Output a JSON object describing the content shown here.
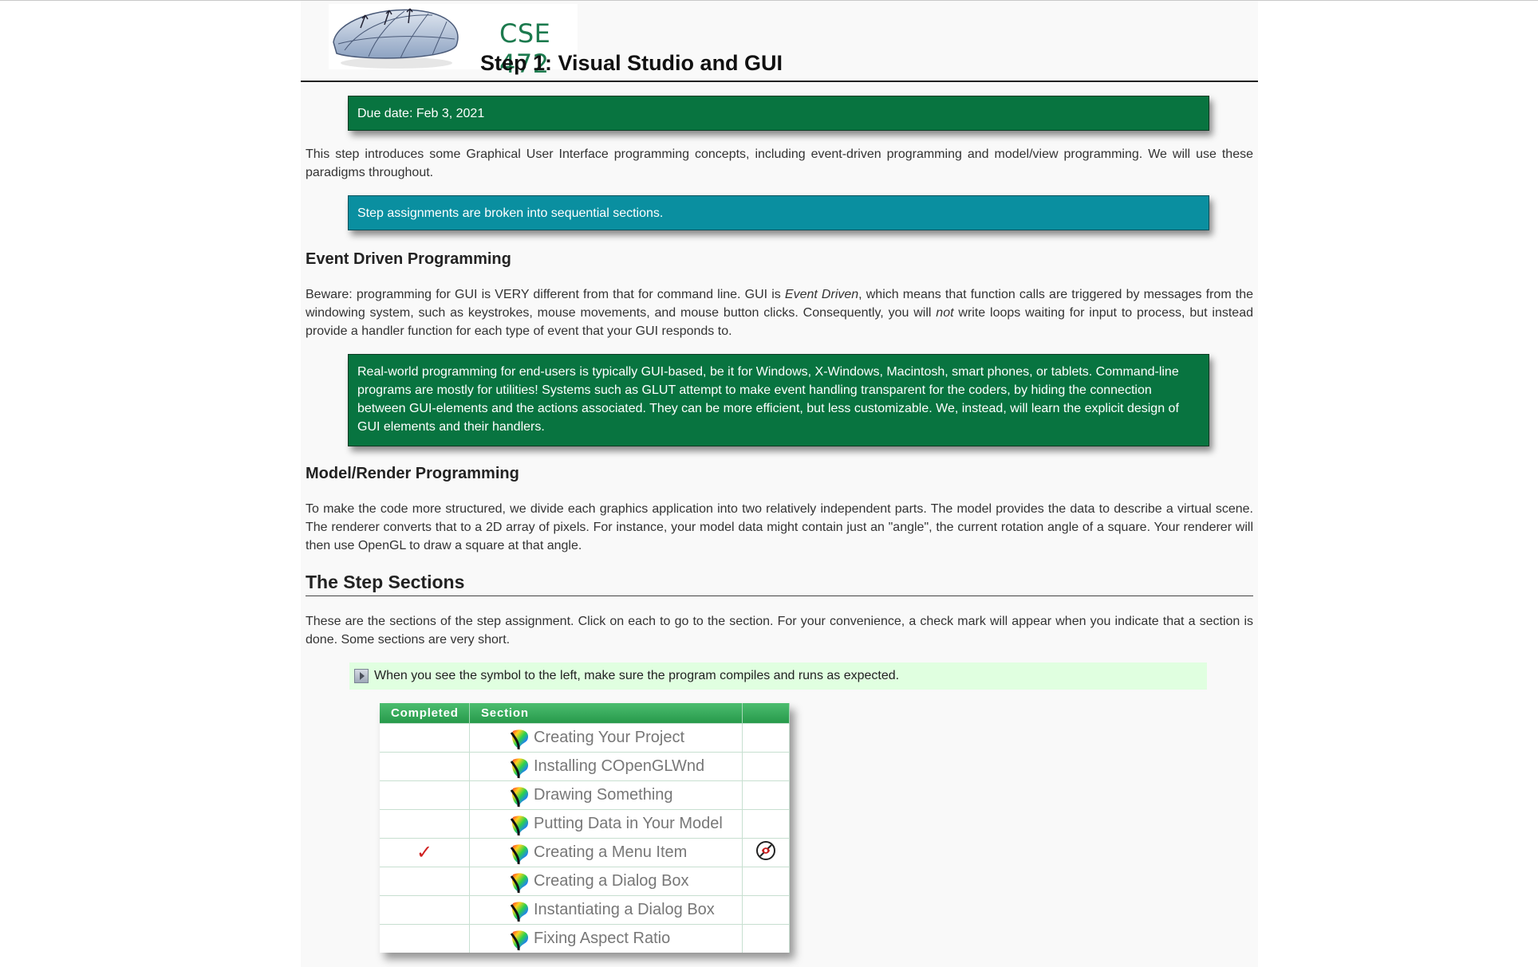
{
  "header": {
    "logo_text": "CSE 472",
    "title": "Step 1: Visual Studio and GUI"
  },
  "due_callout": "Due date: Feb 3, 2021",
  "intro_paragraph": "This step introduces some Graphical User Interface programming concepts, including event-driven programming and model/view programming. We will use these paradigms throughout.",
  "sections_callout": "Step assignments are broken into sequential sections.",
  "event_driven": {
    "heading": "Event Driven Programming",
    "para_part1": "Beware: programming for GUI is VERY different from that for command line. GUI is ",
    "para_em1": "Event Driven",
    "para_part2": ", which means that function calls are triggered by messages from the windowing system, such as keystrokes, mouse movements, and mouse button clicks. Consequently, you will ",
    "para_em2": "not",
    "para_part3": " write loops waiting for input to process, but instead provide a handler function for each type of event that your GUI responds to.",
    "callout": "Real-world programming for end-users is typically GUI-based, be it for Windows, X-Windows, Macintosh, smart phones, or tablets. Command-line programs are mostly for utilities! Systems such as GLUT attempt to make event handling transparent for the coders, by hiding the connection between GUI-elements and the actions associated. They can be more efficient, but less customizable. We, instead, will learn the explicit design of GUI elements and their handlers."
  },
  "model_render": {
    "heading": "Model/Render Programming",
    "paragraph": "To make the code more structured, we divide each graphics application into two relatively independent parts. The model provides the data to describe a virtual scene. The renderer converts that to a 2D array of pixels. For instance, your model data might contain just an \"angle\", the current rotation angle of a square. Your renderer will then use OpenGL to draw a square at that angle."
  },
  "step_sections": {
    "heading": "The Step Sections",
    "paragraph": "These are the sections of the step assignment. Click on each to go to the section. For your convenience, a check mark will appear when you indicate that a section is done. Some sections are very short.",
    "note": "When you see the symbol to the left, make sure the program compiles and runs as expected.",
    "note_icon": "play-icon",
    "table": {
      "headers": [
        "Completed",
        "Section",
        ""
      ],
      "rows": [
        {
          "completed": "",
          "section": "Creating Your Project",
          "icon": "paint-palette-icon",
          "marker": ""
        },
        {
          "completed": "",
          "section": "Installing COpenGLWnd",
          "icon": "paint-palette-icon",
          "marker": ""
        },
        {
          "completed": "",
          "section": "Drawing Something",
          "icon": "paint-palette-icon",
          "marker": ""
        },
        {
          "completed": "",
          "section": "Putting Data in Your Model",
          "icon": "paint-palette-icon",
          "marker": ""
        },
        {
          "completed": "✓",
          "section": "Creating a Menu Item",
          "icon": "paint-palette-icon",
          "marker": "no-symbol-icon"
        },
        {
          "completed": "",
          "section": "Creating a Dialog Box",
          "icon": "paint-palette-icon",
          "marker": ""
        },
        {
          "completed": "",
          "section": "Instantiating a Dialog Box",
          "icon": "paint-palette-icon",
          "marker": ""
        },
        {
          "completed": "",
          "section": "Fixing Aspect Ratio",
          "icon": "paint-palette-icon",
          "marker": ""
        }
      ]
    }
  },
  "colors": {
    "green_callout": "#087440",
    "teal_callout": "#0a8fa0",
    "note_background": "#e0ffe0",
    "table_header": "#3aae5d",
    "check_mark": "#d02020"
  }
}
